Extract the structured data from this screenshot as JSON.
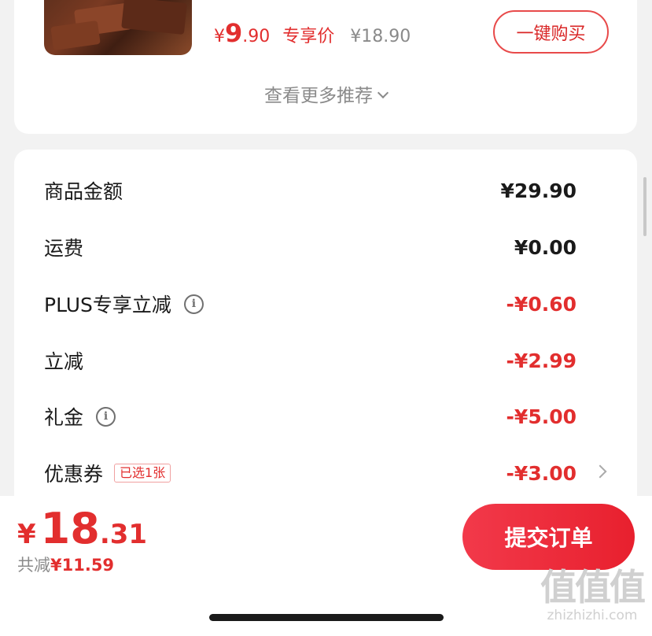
{
  "recommend": {
    "price_yen": "¥",
    "price_int": "9",
    "price_dec": ".90",
    "exclusive_label": "专享价",
    "original_price": "¥18.90",
    "buy_label": "一键购买",
    "more_label": "查看更多推荐"
  },
  "summary": {
    "rows": [
      {
        "label": "商品金额",
        "value": "¥29.90"
      },
      {
        "label": "运费",
        "value": "¥0.00"
      },
      {
        "label": "PLUS专享立减",
        "value": "-¥0.60"
      },
      {
        "label": "立减",
        "value": "-¥2.99"
      },
      {
        "label": "礼金",
        "value": "-¥5.00"
      },
      {
        "label": "优惠券",
        "value": "-¥3.00",
        "tag": "已选1张"
      }
    ],
    "info_glyph": "i"
  },
  "bottom": {
    "total_yen": "¥",
    "total_int": "18",
    "total_dec": ".31",
    "saved_label": "共减",
    "saved_amount": "¥11.59",
    "submit_label": "提交订单"
  },
  "watermark": {
    "logo": "值值值",
    "url": "zhizhizhi.com"
  },
  "colors": {
    "accent_red": "#e22e2e",
    "button_red": "#e8202e",
    "background": "#f2f2f2"
  }
}
